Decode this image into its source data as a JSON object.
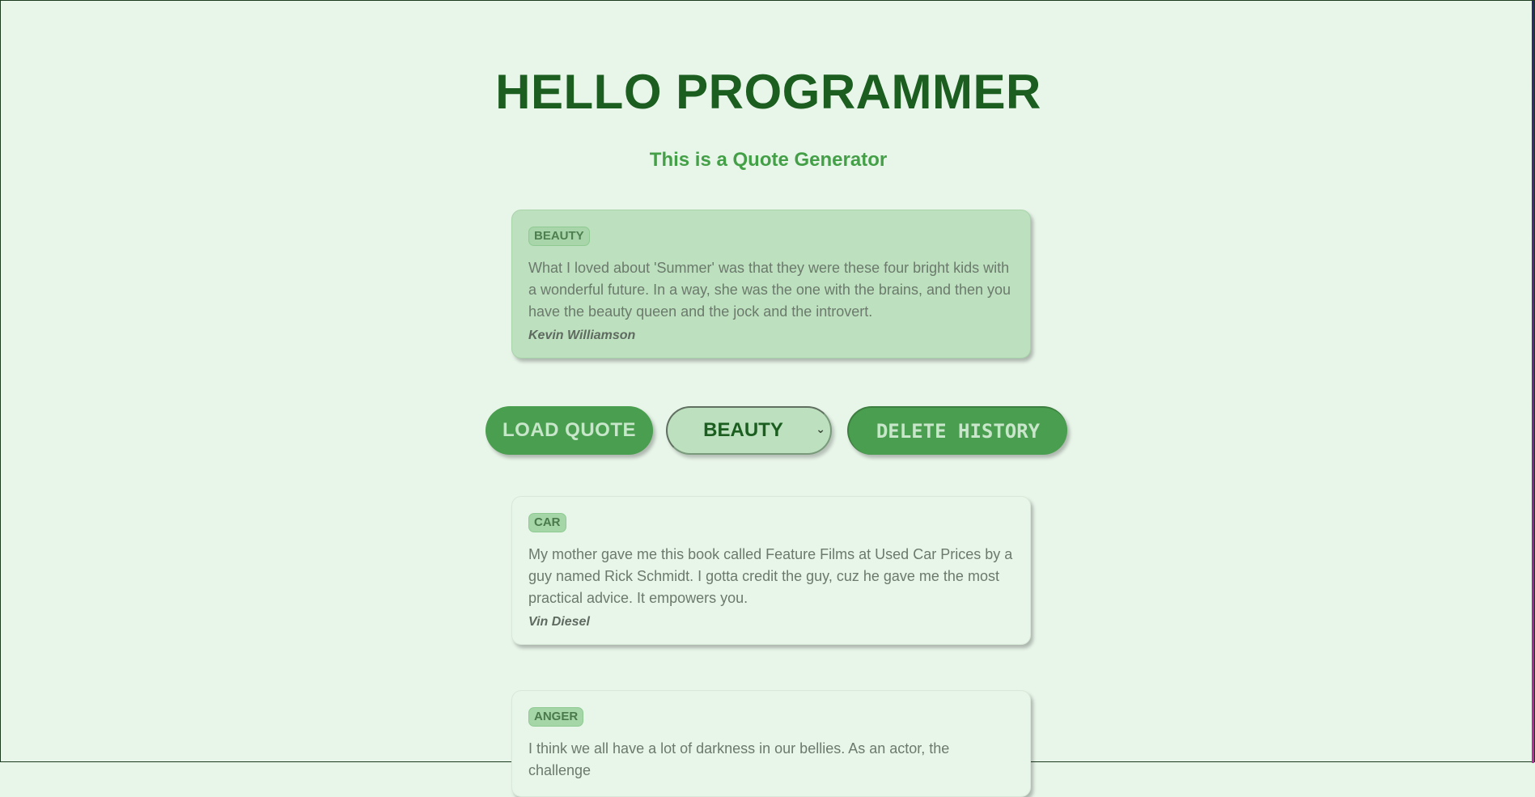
{
  "header": {
    "title": "HELLO PROGRAMMER",
    "subtitle": "This is a Quote Generator"
  },
  "current_quote": {
    "tag": "BEAUTY",
    "text": "What I loved about 'Summer' was that they were these four bright kids with a wonderful future. In a way, she was the one with the brains, and then you have the beauty queen and the jock and the introvert.",
    "author": "Kevin Williamson"
  },
  "controls": {
    "load_label": "LOAD QUOTE",
    "category_selected": "BEAUTY",
    "delete_label": "DELETE HISTORY"
  },
  "history": [
    {
      "tag": "CAR",
      "text": "My mother gave me this book called Feature Films at Used Car Prices by a guy named Rick Schmidt. I gotta credit the guy, cuz he gave me the most practical advice. It empowers you.",
      "author": "Vin Diesel"
    },
    {
      "tag": "ANGER",
      "text": "I think we all have a lot of darkness in our bellies. As an actor, the challenge",
      "author": ""
    }
  ],
  "colors": {
    "background": "#e8f5e9",
    "title": "#1b5e20",
    "subtitle": "#43a047",
    "button": "#4a9e4f",
    "active_card": "#bde0be"
  }
}
